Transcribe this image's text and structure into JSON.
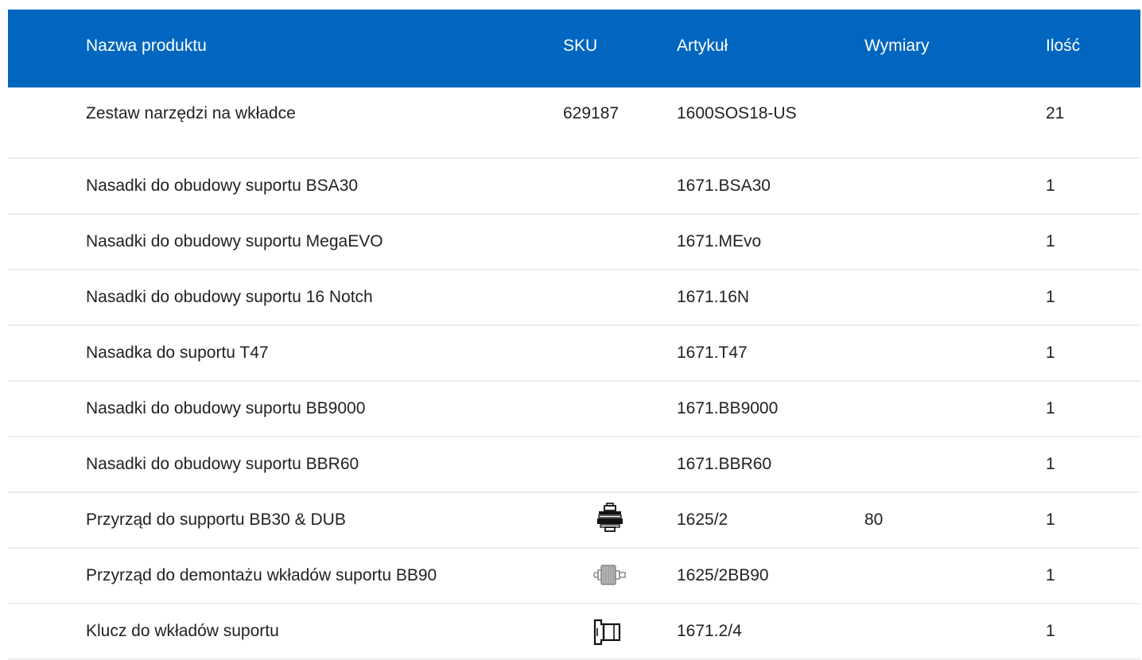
{
  "table": {
    "headers": {
      "name": "Nazwa produktu",
      "sku": "SKU",
      "article": "Artykuł",
      "dimensions": "Wymiary",
      "quantity": "Ilość"
    },
    "rows": [
      {
        "name": "Zestaw narzędzi na wkładce",
        "sku": "629187",
        "sku_icon": "",
        "article": "1600SOS18-US",
        "dimensions": "",
        "quantity": "21"
      },
      {
        "name": "Nasadki do obudowy suportu BSA30",
        "sku": "",
        "sku_icon": "",
        "article": "1671.BSA30",
        "dimensions": "",
        "quantity": "1"
      },
      {
        "name": "Nasadki do obudowy suportu MegaEVO",
        "sku": "",
        "sku_icon": "",
        "article": "1671.MEvo",
        "dimensions": "",
        "quantity": "1"
      },
      {
        "name": "Nasadki do obudowy suportu 16 Notch",
        "sku": "",
        "sku_icon": "",
        "article": "1671.16N",
        "dimensions": "",
        "quantity": "1"
      },
      {
        "name": "Nasadka do suportu T47",
        "sku": "",
        "sku_icon": "",
        "article": "1671.T47",
        "dimensions": "",
        "quantity": "1"
      },
      {
        "name": "Nasadki do obudowy suportu BB9000",
        "sku": "",
        "sku_icon": "",
        "article": "1671.BB9000",
        "dimensions": "",
        "quantity": "1"
      },
      {
        "name": "Nasadki do obudowy suportu BBR60",
        "sku": "",
        "sku_icon": "",
        "article": "1671.BBR60",
        "dimensions": "",
        "quantity": "1"
      },
      {
        "name": "Przyrząd do supportu BB30 & DUB",
        "sku": "",
        "sku_icon": "press-tool-icon",
        "article": "1625/2",
        "dimensions": "80",
        "quantity": "1"
      },
      {
        "name": "Przyrząd do demontażu wkładów suportu BB90",
        "sku": "",
        "sku_icon": "remover-tool-icon",
        "article": "1625/2BB90",
        "dimensions": "",
        "quantity": "1"
      },
      {
        "name": "Klucz do wkładów suportu",
        "sku": "",
        "sku_icon": "cartridge-key-icon",
        "article": "1671.2/4",
        "dimensions": "",
        "quantity": "1"
      }
    ]
  },
  "colors": {
    "header_bg": "#0066bf",
    "header_text": "#ffffff",
    "row_text": "#222222",
    "divider": "#ececec"
  }
}
